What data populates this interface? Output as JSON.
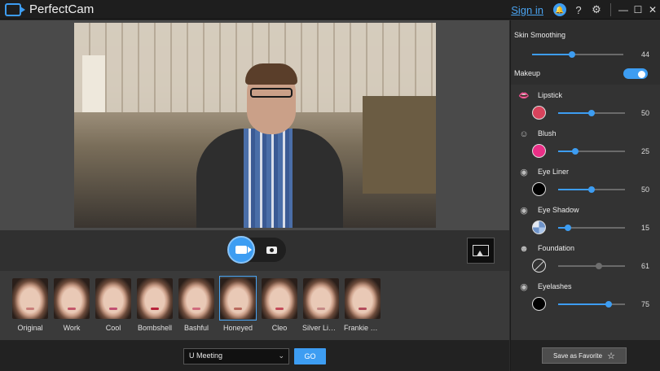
{
  "app": {
    "title": "PerfectCam"
  },
  "titlebar": {
    "signin_label": "Sign in",
    "icons": [
      "notification-icon",
      "help-icon",
      "settings-icon"
    ],
    "help_glyph": "?",
    "settings_glyph": "⚙",
    "window_controls": {
      "minimize": "—",
      "maximize": "☐",
      "close": "✕"
    }
  },
  "controls": {
    "mode_video": "video-camera-icon",
    "mode_photo": "photo-camera-icon",
    "gallery": "gallery-icon"
  },
  "presets": [
    {
      "label": "Original",
      "lip": "#c97e7a",
      "selected": false
    },
    {
      "label": "Work",
      "lip": "#c4566a",
      "selected": false
    },
    {
      "label": "Cool",
      "lip": "#c24f72",
      "selected": false
    },
    {
      "label": "Bombshell",
      "lip": "#b8223a",
      "selected": false
    },
    {
      "label": "Bashful",
      "lip": "#d06b7d",
      "selected": false
    },
    {
      "label": "Honeyed",
      "lip": "#b96a5e",
      "selected": true
    },
    {
      "label": "Cleo",
      "lip": "#c44b5a",
      "selected": false
    },
    {
      "label": "Silver Lini...",
      "lip": "#c58a86",
      "selected": false
    },
    {
      "label": "Frankie R...",
      "lip": "#b34b5b",
      "selected": false
    }
  ],
  "meeting": {
    "selected": "U Meeting",
    "go_label": "GO"
  },
  "panel": {
    "skin_smoothing": {
      "label": "Skin Smoothing",
      "value": "44",
      "level": 0.44
    },
    "makeup": {
      "label": "Makeup",
      "enabled": true
    },
    "items": [
      {
        "label": "Lipstick",
        "icon": "lips-icon",
        "color": "#d8435c",
        "value": "50",
        "level": 0.5,
        "enabled": true
      },
      {
        "label": "Blush",
        "icon": "blush-icon",
        "color": "#ea2f87",
        "value": "25",
        "level": 0.25,
        "enabled": true
      },
      {
        "label": "Eye Liner",
        "icon": "eye-liner-icon",
        "color": "#000000",
        "value": "50",
        "level": 0.5,
        "enabled": true
      },
      {
        "label": "Eye Shadow",
        "icon": "eye-shadow-icon",
        "color": "multi",
        "value": "15",
        "level": 0.15,
        "enabled": true
      },
      {
        "label": "Foundation",
        "icon": "foundation-icon",
        "color": "none",
        "value": "61",
        "level": 0.61,
        "enabled": false
      },
      {
        "label": "Eyelashes",
        "icon": "eyelashes-icon",
        "color": "#000000",
        "value": "75",
        "level": 0.75,
        "enabled": true
      }
    ],
    "favorite_label": "Save as Favorite"
  },
  "colors": {
    "accent": "#3d9df2",
    "panel": "#333333",
    "titlebar": "#1e1e1e"
  }
}
